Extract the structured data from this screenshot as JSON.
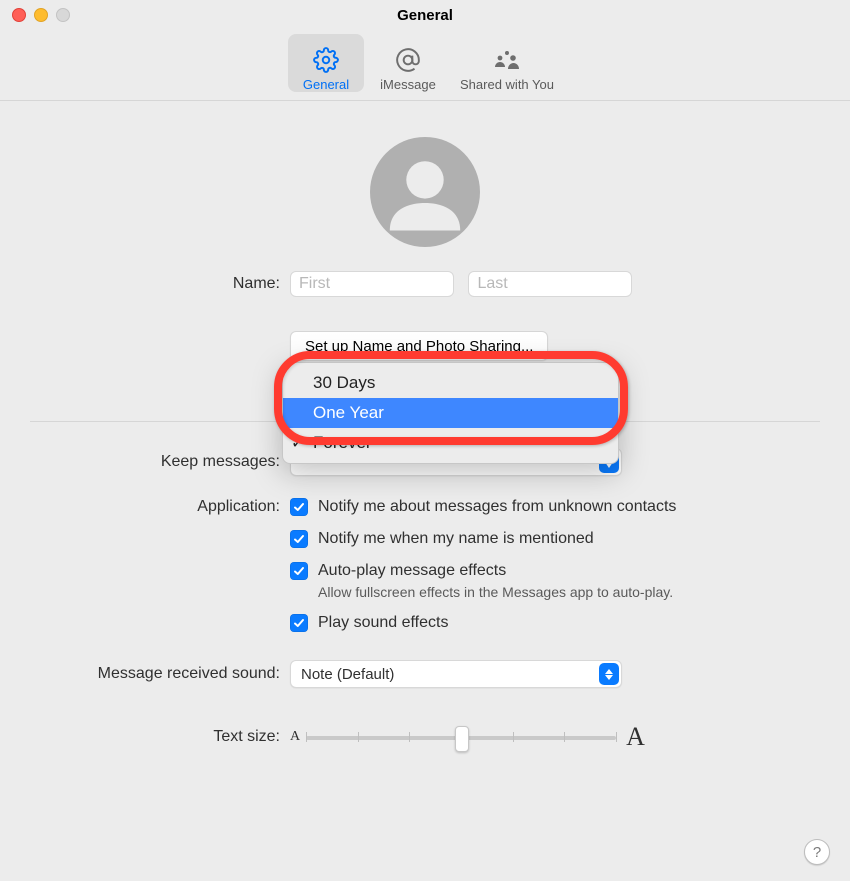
{
  "window_title": "General",
  "tabs": {
    "general": "General",
    "imessage": "iMessage",
    "shared": "Shared with You"
  },
  "name_label": "Name:",
  "first_ph": "First",
  "last_ph": "Last",
  "setup_btn": "Set up Name and Photo Sharing...",
  "keep_label": "Keep messages:",
  "keep_menu": {
    "opt0": "30 Days",
    "opt1": "One Year",
    "opt2": "Forever"
  },
  "app_label": "Application:",
  "chk_unknown": "Notify me about messages from unknown contacts",
  "chk_mention": "Notify me when my name is mentioned",
  "chk_autoplay": "Auto-play message effects",
  "chk_autoplay_sub": "Allow fullscreen effects in the Messages app to auto-play.",
  "chk_sound": "Play sound effects",
  "msg_sound_label": "Message received sound:",
  "msg_sound_value": "Note (Default)",
  "text_size_label": "Text size:",
  "small_A": "A",
  "big_A": "A",
  "help": "?"
}
